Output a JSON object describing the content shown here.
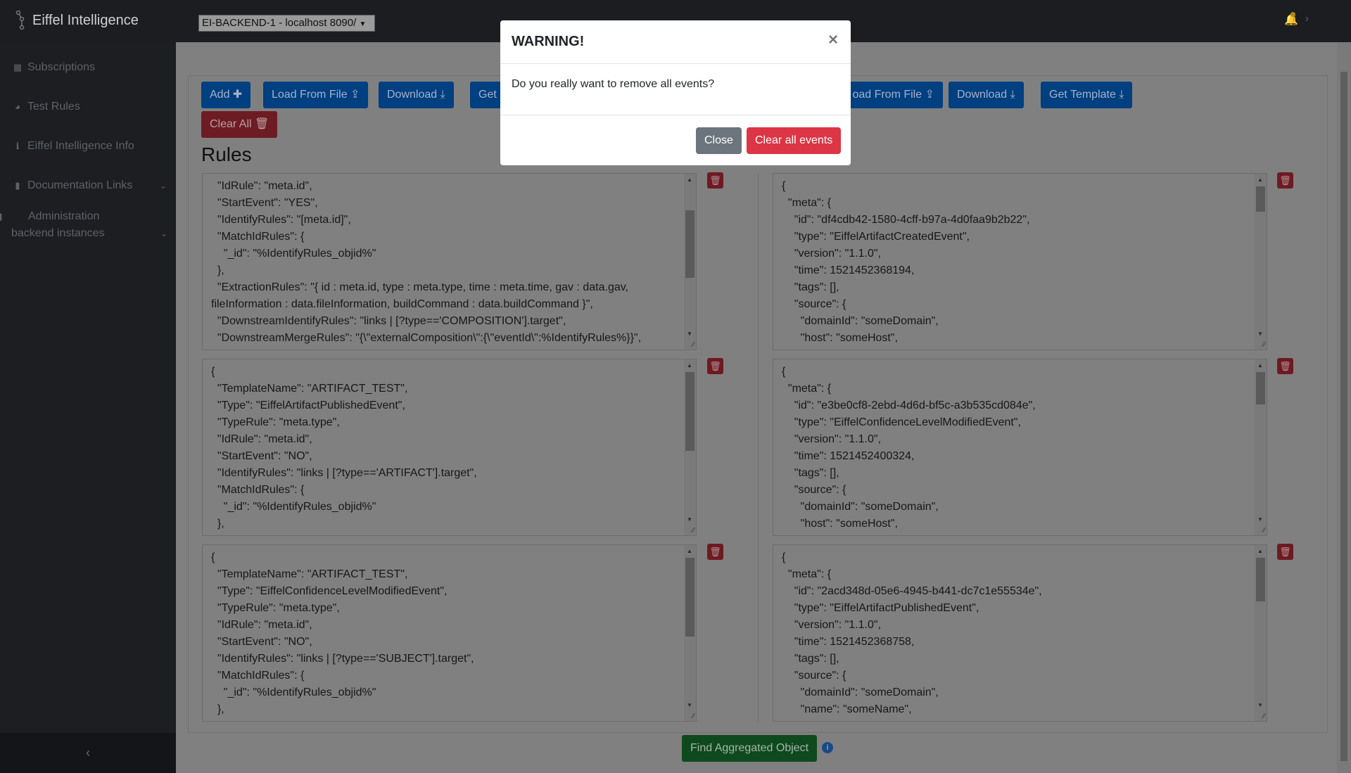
{
  "topbar": {
    "brand": "Eiffel Intelligence",
    "backend_select": "EI-BACKEND-1 - localhost 8090/"
  },
  "sidebar": {
    "items": [
      {
        "label": "Subscriptions",
        "icon": "table-icon"
      },
      {
        "label": "Test Rules",
        "icon": "dashboard-icon"
      },
      {
        "label": "Eiffel Intelligence Info",
        "icon": "info-icon"
      },
      {
        "label": "Documentation Links",
        "icon": "file-icon"
      },
      {
        "label": "Administration backend instances",
        "icon": "file-icon"
      }
    ],
    "collapse": "‹"
  },
  "rules_toolbar": {
    "add": "Add",
    "load": "Load From File",
    "download": "Download",
    "get_template": "Get",
    "clear_all": "Clear All"
  },
  "events_toolbar": {
    "load": "oad From File",
    "download": "Download",
    "get_template": "Get Template"
  },
  "rules_heading": "Rules",
  "rules": [
    {
      "text": "  \"IdRule\": \"meta.id\",\n  \"StartEvent\": \"YES\",\n  \"IdentifyRules\": \"[meta.id]\",\n  \"MatchIdRules\": {\n    \"_id\": \"%IdentifyRules_objid%\"\n  },\n  \"ExtractionRules\": \"{ id : meta.id, type : meta.type, time : meta.time, gav : data.gav, fileInformation : data.fileInformation, buildCommand : data.buildCommand }\",\n  \"DownstreamIdentifyRules\": \"links | [?type=='COMPOSITION'].target\",\n  \"DownstreamMergeRules\": \"{\\\"externalComposition\\\":{\\\"eventId\\\":%IdentifyRules%}}\","
    },
    {
      "text": "{\n  \"TemplateName\": \"ARTIFACT_TEST\",\n  \"Type\": \"EiffelArtifactPublishedEvent\",\n  \"TypeRule\": \"meta.type\",\n  \"IdRule\": \"meta.id\",\n  \"StartEvent\": \"NO\",\n  \"IdentifyRules\": \"links | [?type=='ARTIFACT'].target\",\n  \"MatchIdRules\": {\n    \"_id\": \"%IdentifyRules_objid%\"\n  },"
    },
    {
      "text": "{\n  \"TemplateName\": \"ARTIFACT_TEST\",\n  \"Type\": \"EiffelConfidenceLevelModifiedEvent\",\n  \"TypeRule\": \"meta.type\",\n  \"IdRule\": \"meta.id\",\n  \"StartEvent\": \"NO\",\n  \"IdentifyRules\": \"links | [?type=='SUBJECT'].target\",\n  \"MatchIdRules\": {\n    \"_id\": \"%IdentifyRules_objid%\"\n  },"
    }
  ],
  "events": [
    {
      "text": "{\n  \"meta\": {\n    \"id\": \"df4cdb42-1580-4cff-b97a-4d0faa9b2b22\",\n    \"type\": \"EiffelArtifactCreatedEvent\",\n    \"version\": \"1.1.0\",\n    \"time\": 1521452368194,\n    \"tags\": [],\n    \"source\": {\n      \"domainId\": \"someDomain\",\n      \"host\": \"someHost\","
    },
    {
      "text": "{\n  \"meta\": {\n    \"id\": \"e3be0cf8-2ebd-4d6d-bf5c-a3b535cd084e\",\n    \"type\": \"EiffelConfidenceLevelModifiedEvent\",\n    \"version\": \"1.1.0\",\n    \"time\": 1521452400324,\n    \"tags\": [],\n    \"source\": {\n      \"domainId\": \"someDomain\",\n      \"host\": \"someHost\","
    },
    {
      "text": "{\n  \"meta\": {\n    \"id\": \"2acd348d-05e6-4945-b441-dc7c1e55534e\",\n    \"type\": \"EiffelArtifactPublishedEvent\",\n    \"version\": \"1.1.0\",\n    \"time\": 1521452368758,\n    \"tags\": [],\n    \"source\": {\n      \"domainId\": \"someDomain\",\n      \"name\": \"someName\","
    }
  ],
  "find_button": "Find Aggregated Object",
  "modal": {
    "title": "WARNING!",
    "close_x": "×",
    "message": "Do you really want to remove all events?",
    "close": "Close",
    "confirm": "Clear all events"
  },
  "colors": {
    "primary": "#007bff",
    "danger": "#dc3545",
    "secondary": "#6c757d",
    "success": "#28a745"
  }
}
